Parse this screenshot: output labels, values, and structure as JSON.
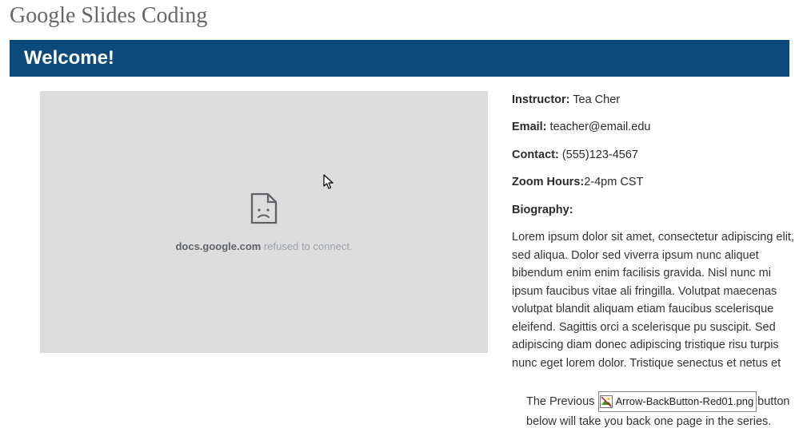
{
  "page": {
    "title": "Google Slides Coding"
  },
  "banner": {
    "text": "Welcome!"
  },
  "embed": {
    "domain": "docs.google.com",
    "suffix": " refused to connect."
  },
  "info": {
    "instructor_label": "Instructor:",
    "instructor_value": " Tea Cher",
    "email_label": "Email:",
    "email_value": " teacher@email.edu",
    "contact_label": "Contact:",
    "contact_value": " (555)123-4567",
    "zoom_label": "Zoom Hours:",
    "zoom_value": "2-4pm CST",
    "biography_label": "Biography:",
    "biography_text": "Lorem ipsum dolor sit amet, consectetur adipiscing elit, sed aliqua. Dolor sed viverra ipsum nunc aliquet bibendum enim enim facilisis gravida. Nisl nunc mi ipsum faucibus vitae ali fringilla. Volutpat maecenas volutpat blandit aliquam etiam faucibus scelerisque eleifend. Sagittis orci a scelerisque pu suscipit. Sed adipiscing diam donec adipiscing tristique risu turpis nunc eget lorem dolor. Tristique senectus et netus et"
  },
  "nav": {
    "prefix": "The Previous ",
    "broken_alt": "Arrow-BackButton-Red01.png",
    "suffix1": "button",
    "line2": "below will take you back one page in the series."
  }
}
